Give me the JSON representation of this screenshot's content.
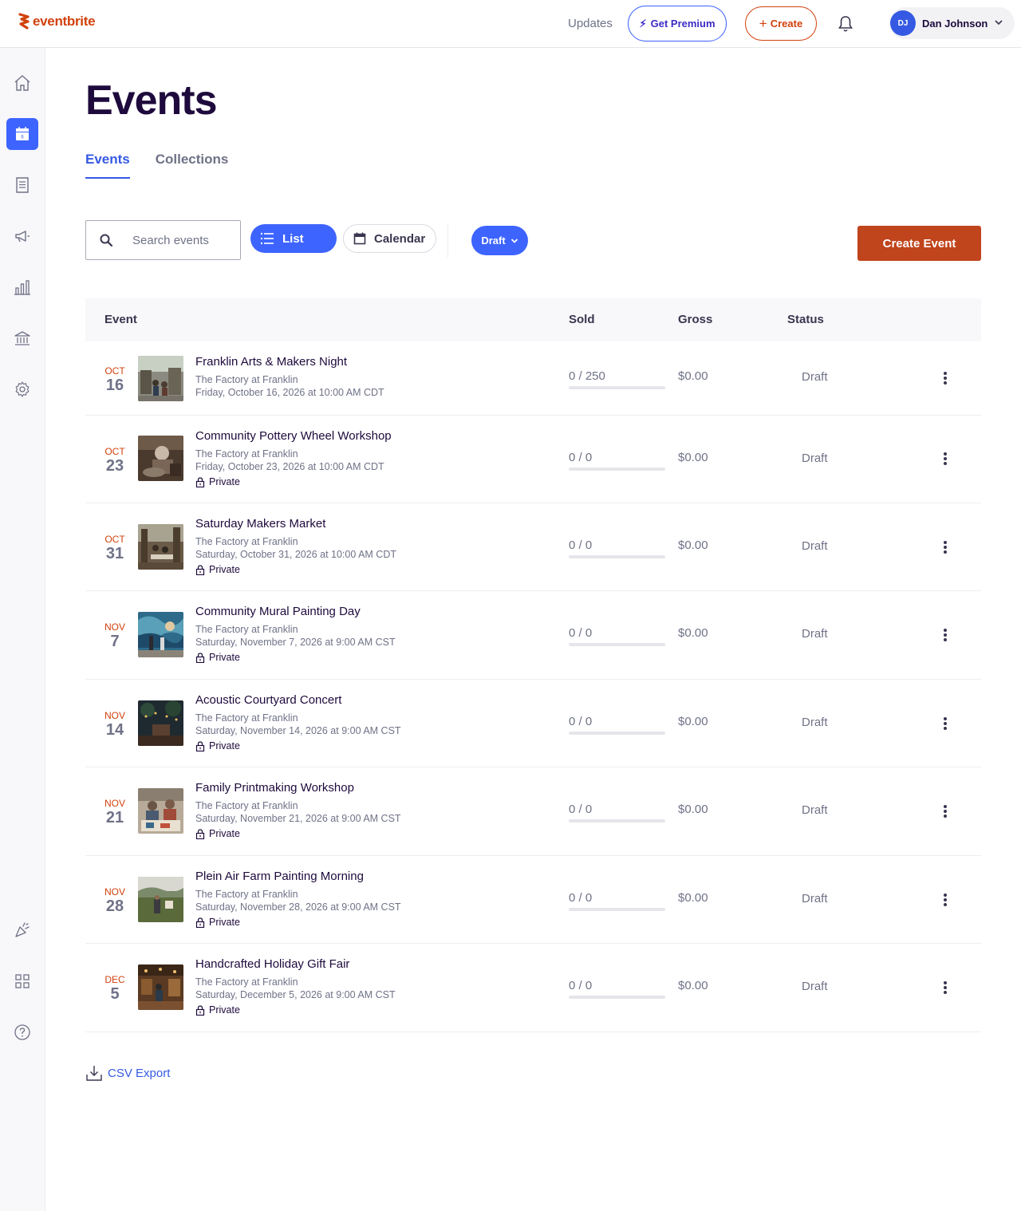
{
  "header": {
    "logo_text": "eventbrite",
    "updates_label": "Updates",
    "premium_label": "Get Premium",
    "create_label": "Create",
    "user_initials": "DJ",
    "user_name": "Dan Johnson"
  },
  "sidebar": {
    "calendar_day": "6"
  },
  "page": {
    "title": "Events",
    "tabs": [
      "Events",
      "Collections"
    ],
    "active_tab": "Events"
  },
  "toolbar": {
    "search_placeholder": "Search events",
    "list_label": "List",
    "calendar_label": "Calendar",
    "filter_label": "Draft",
    "create_event_label": "Create Event"
  },
  "table": {
    "headers": {
      "event": "Event",
      "sold": "Sold",
      "gross": "Gross",
      "status": "Status"
    },
    "rows": [
      {
        "month": "OCT",
        "day": "16",
        "title": "Franklin Arts & Makers Night",
        "venue": "The Factory at Franklin",
        "datetime": "Friday, October 16, 2026 at 10:00 AM CDT",
        "private_label": "",
        "sold": "0 / 250",
        "gross": "$0.00",
        "status": "Draft"
      },
      {
        "month": "OCT",
        "day": "23",
        "title": "Community Pottery Wheel Workshop",
        "venue": "The Factory at Franklin",
        "datetime": "Friday, October 23, 2026 at 10:00 AM CDT",
        "private_label": "Private",
        "sold": "0 / 0",
        "gross": "$0.00",
        "status": "Draft"
      },
      {
        "month": "OCT",
        "day": "31",
        "title": "Saturday Makers Market",
        "venue": "The Factory at Franklin",
        "datetime": "Saturday, October 31, 2026 at 10:00 AM CDT",
        "private_label": "Private",
        "sold": "0 / 0",
        "gross": "$0.00",
        "status": "Draft"
      },
      {
        "month": "NOV",
        "day": "7",
        "title": "Community Mural Painting Day",
        "venue": "The Factory at Franklin",
        "datetime": "Saturday, November 7, 2026 at 9:00 AM CST",
        "private_label": "Private",
        "sold": "0 / 0",
        "gross": "$0.00",
        "status": "Draft"
      },
      {
        "month": "NOV",
        "day": "14",
        "title": "Acoustic Courtyard Concert",
        "venue": "The Factory at Franklin",
        "datetime": "Saturday, November 14, 2026 at 9:00 AM CST",
        "private_label": "Private",
        "sold": "0 / 0",
        "gross": "$0.00",
        "status": "Draft"
      },
      {
        "month": "NOV",
        "day": "21",
        "title": "Family Printmaking Workshop",
        "venue": "The Factory at Franklin",
        "datetime": "Saturday, November 21, 2026 at 9:00 AM CST",
        "private_label": "Private",
        "sold": "0 / 0",
        "gross": "$0.00",
        "status": "Draft"
      },
      {
        "month": "NOV",
        "day": "28",
        "title": "Plein Air Farm Painting Morning",
        "venue": "The Factory at Franklin",
        "datetime": "Saturday, November 28, 2026 at 9:00 AM CST",
        "private_label": "Private",
        "sold": "0 / 0",
        "gross": "$0.00",
        "status": "Draft"
      },
      {
        "month": "DEC",
        "day": "5",
        "title": "Handcrafted Holiday Gift Fair",
        "venue": "The Factory at Franklin",
        "datetime": "Saturday, December 5, 2026 at 9:00 AM CST",
        "private_label": "Private",
        "sold": "0 / 0",
        "gross": "$0.00",
        "status": "Draft"
      }
    ]
  },
  "footer": {
    "csv_label": "CSV Export"
  },
  "colors": {
    "brand_orange": "#d1410c",
    "accent_blue": "#3d64ff",
    "create_event_bg": "#c0441c",
    "text_dark": "#1e0a3c",
    "text_muted": "#6f7287"
  }
}
